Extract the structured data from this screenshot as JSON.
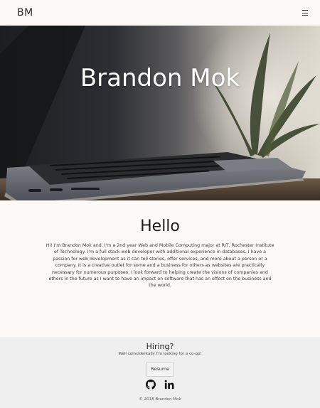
{
  "header": {
    "brand": "BM",
    "menu_icon": "hamburger-icon"
  },
  "hero": {
    "title": "Brandon Mok",
    "image": "laptop-on-desk-photo"
  },
  "about": {
    "heading": "Hello",
    "body": "Hi! I'm Brandon Mok and, I'm a 2nd year Web and Mobile Computing major at RIT, Rochester Institute of Technology. I'm a full stack web developer with additional experience in databases. I have a passion for web development as it can tell stories, offer services, and more about a person or a company. It is a creative outlet for some and a business for others as websites are practically necessary for numerous purposes. I look forward to helping create the visions of companies and others in the future as I want to have an impact on software that has an effect on the business and the world."
  },
  "footer": {
    "heading": "Hiring?",
    "subtext": "Well coincidentally I'm looking for a co-op!",
    "resume_label": "Resume",
    "social": [
      {
        "icon": "github-icon"
      },
      {
        "icon": "linkedin-icon"
      }
    ],
    "copyright": "© 2018 Brandon Mok"
  }
}
